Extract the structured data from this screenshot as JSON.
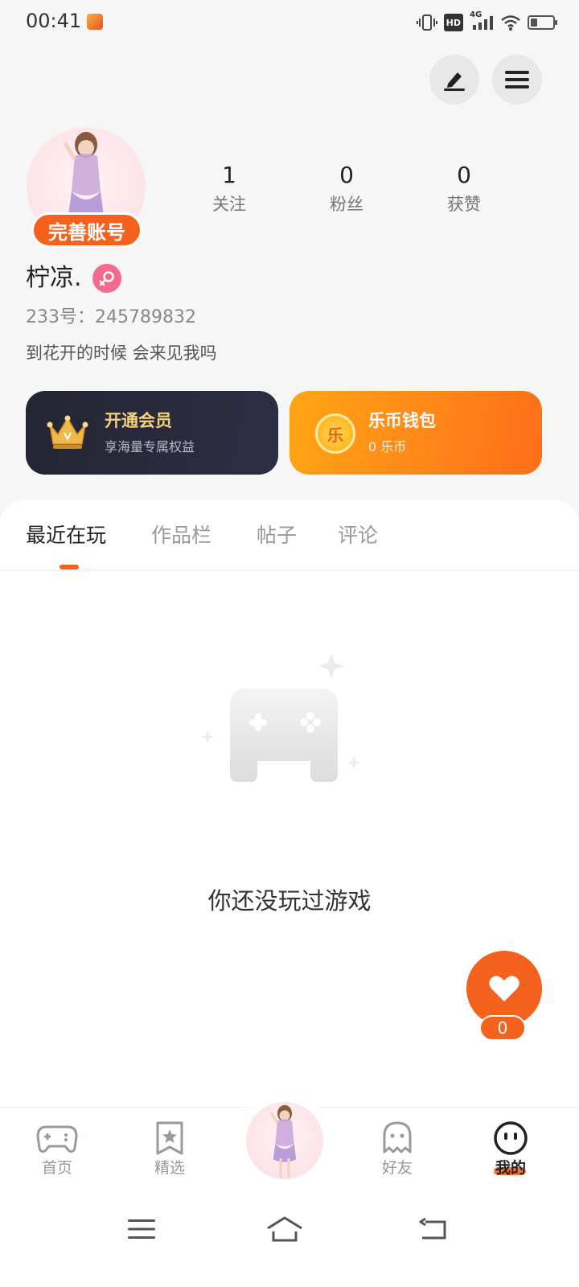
{
  "status_bar": {
    "time": "00:41",
    "network": "4G",
    "hd": "HD"
  },
  "profile": {
    "complete_badge": "完善账号",
    "name": "柠凉.",
    "user_id": "233号：245789832",
    "bio": "到花开的时候  会来见我吗",
    "stats": [
      {
        "value": "1",
        "label": "关注"
      },
      {
        "value": "0",
        "label": "粉丝"
      },
      {
        "value": "0",
        "label": "获赞"
      }
    ]
  },
  "cards": {
    "vip": {
      "title": "开通会员",
      "subtitle": "享海量专属权益"
    },
    "wallet": {
      "title": "乐币钱包",
      "subtitle": "0  乐币",
      "coin_glyph": "乐"
    }
  },
  "tabs": [
    "最近在玩",
    "作品栏",
    "帖子",
    "评论"
  ],
  "empty_state": {
    "text": "你还没玩过游戏"
  },
  "like_fab": {
    "count": "0"
  },
  "bottom_nav": {
    "items": [
      {
        "label": "首页",
        "icon": "gamepad-icon"
      },
      {
        "label": "精选",
        "icon": "star-bookmark-icon"
      },
      {
        "label": "好友",
        "icon": "ghost-icon"
      },
      {
        "label": "我的",
        "icon": "smiley-icon"
      }
    ]
  },
  "colors": {
    "accent": "#f5621e",
    "vip_gold": "#f3d27a",
    "wallet_orange": "#ff8419"
  }
}
